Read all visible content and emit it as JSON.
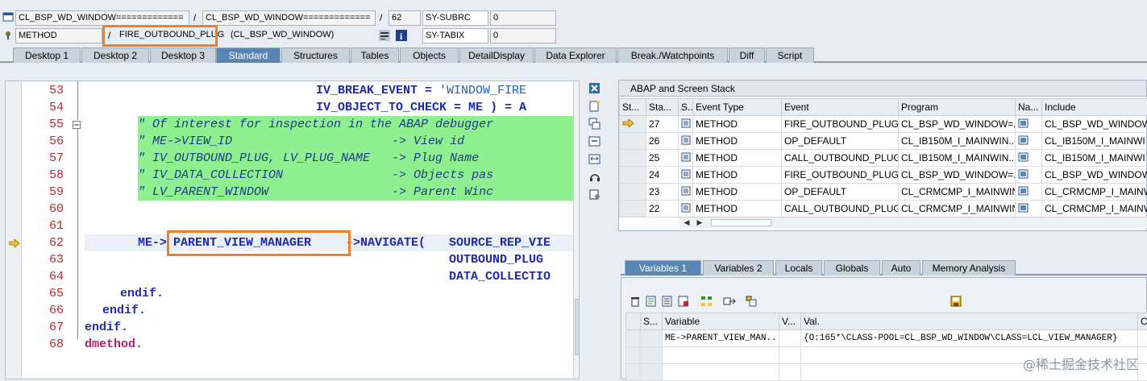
{
  "header": {
    "row1": {
      "f1": "CL_BSP_WD_WINDOW=============",
      "f2": "CL_BSP_WD_WINDOW=============",
      "f3": "62",
      "f4": "SY-SUBRC",
      "f5": "0",
      "slash1": "/",
      "slash2": "/"
    },
    "row2": {
      "f1": "METHOD",
      "f2": "FIRE_OUTBOUND_PLUG",
      "f3": "(CL_BSP_WD_WINDOW)",
      "f4": "SY-TABIX",
      "f5": "0",
      "slash1": "/"
    }
  },
  "tabs": [
    "Desktop 1",
    "Desktop 2",
    "Desktop 3",
    "Standard",
    "Structures",
    "Tables",
    "Objects",
    "DetailDisplay",
    "Data Explorer",
    "Break./Watchpoints",
    "Diff",
    "Script"
  ],
  "active_tab": "Standard",
  "editor": {
    "lines": [
      {
        "n": "53"
      },
      {
        "n": "54"
      },
      {
        "n": "55"
      },
      {
        "n": "56"
      },
      {
        "n": "57"
      },
      {
        "n": "58"
      },
      {
        "n": "59"
      },
      {
        "n": "60"
      },
      {
        "n": "61"
      },
      {
        "n": "62"
      },
      {
        "n": "63"
      },
      {
        "n": "64"
      },
      {
        "n": "65"
      },
      {
        "n": "66"
      },
      {
        "n": "67"
      },
      {
        "n": "68"
      }
    ],
    "code": {
      "l53a": "IV_BREAK_EVENT = ",
      "l53b": "'WINDOW_FIRE",
      "l54": "IV_OBJECT_TO_CHECK = ME ) = A",
      "l55": "\" Of interest for inspection in the ABAP debugger",
      "l56": "\" ME->VIEW_ID                      -> View id",
      "l57": "\" IV_OUTBOUND_PLUG, LV_PLUG_NAME   -> Plug Name",
      "l58": "\" IV_DATA_COLLECTION               -> Objects pas",
      "l59": "\" LV_PARENT_WINDOW                 -> Parent Winc",
      "l62a": "ME->",
      "l62b": "PARENT_VIEW_MANAGER",
      "l62c": "->NAVIGATE(",
      "l62d": "SOURCE_REP_VIE",
      "l63": "OUTBOUND_PLUG",
      "l64": "DATA_COLLECTIO",
      "l65": "endif.",
      "l66": "endif.",
      "l67": "endif.",
      "l68": "dmethod."
    }
  },
  "stack": {
    "title": "ABAP and Screen Stack",
    "columns": [
      "St...",
      "Sta...",
      "S...",
      "Event Type",
      "Event",
      "Program",
      "Na...",
      "Include"
    ],
    "rows": [
      {
        "level": "27",
        "type": "METHOD",
        "event": "FIRE_OUTBOUND_PLUG",
        "program": "CL_BSP_WD_WINDOW=...",
        "include": "CL_BSP_WD_WINDOW",
        "current": true
      },
      {
        "level": "26",
        "type": "METHOD",
        "event": "OP_DEFAULT",
        "program": "CL_IB150M_I_MAINWIN...",
        "include": "CL_IB150M_I_MAINWI",
        "current": false
      },
      {
        "level": "25",
        "type": "METHOD",
        "event": "CALL_OUTBOUND_PLUG",
        "program": "CL_IB150M_I_MAINWIN...",
        "include": "CL_IB150M_I_MAINWI",
        "current": false
      },
      {
        "level": "24",
        "type": "METHOD",
        "event": "FIRE_OUTBOUND_PLUG",
        "program": "CL_BSP_WD_WINDOW=...",
        "include": "CL_BSP_WD_WINDOW",
        "current": false
      },
      {
        "level": "23",
        "type": "METHOD",
        "event": "OP_DEFAULT",
        "program": "CL_CRMCMP_I_MAINWIN...",
        "include": "CL_CRMCMP_I_MAINWI",
        "current": false
      },
      {
        "level": "22",
        "type": "METHOD",
        "event": "CALL_OUTBOUND_PLUG",
        "program": "CL_CRMCMP_I_MAINWIN...",
        "include": "CL_CRMCMP_I_MAINWI",
        "current": false
      }
    ]
  },
  "var_tabs": [
    "Variables 1",
    "Variables 2",
    "Locals",
    "Globals",
    "Auto",
    "Memory Analysis"
  ],
  "active_var_tab": "Variables 1",
  "variables": {
    "columns": [
      "S...",
      "Variable",
      "V...",
      "Val.",
      "C..."
    ],
    "rows": [
      {
        "name": "ME->PARENT_VIEW_MAN...",
        "value": "{O:165*\\CLASS-POOL=CL_BSP_WD_WINDOW\\CLASS=LCL_VIEW_MANAGER}"
      },
      {
        "name": "",
        "value": ""
      },
      {
        "name": "",
        "value": ""
      }
    ]
  },
  "watermark": "@稀土掘金技术社区",
  "colors": {
    "highlight": "#f07f2a",
    "comment_bg": "#8ef08e",
    "line_number": "#c0282a",
    "active_tab": "#5a86b3"
  }
}
